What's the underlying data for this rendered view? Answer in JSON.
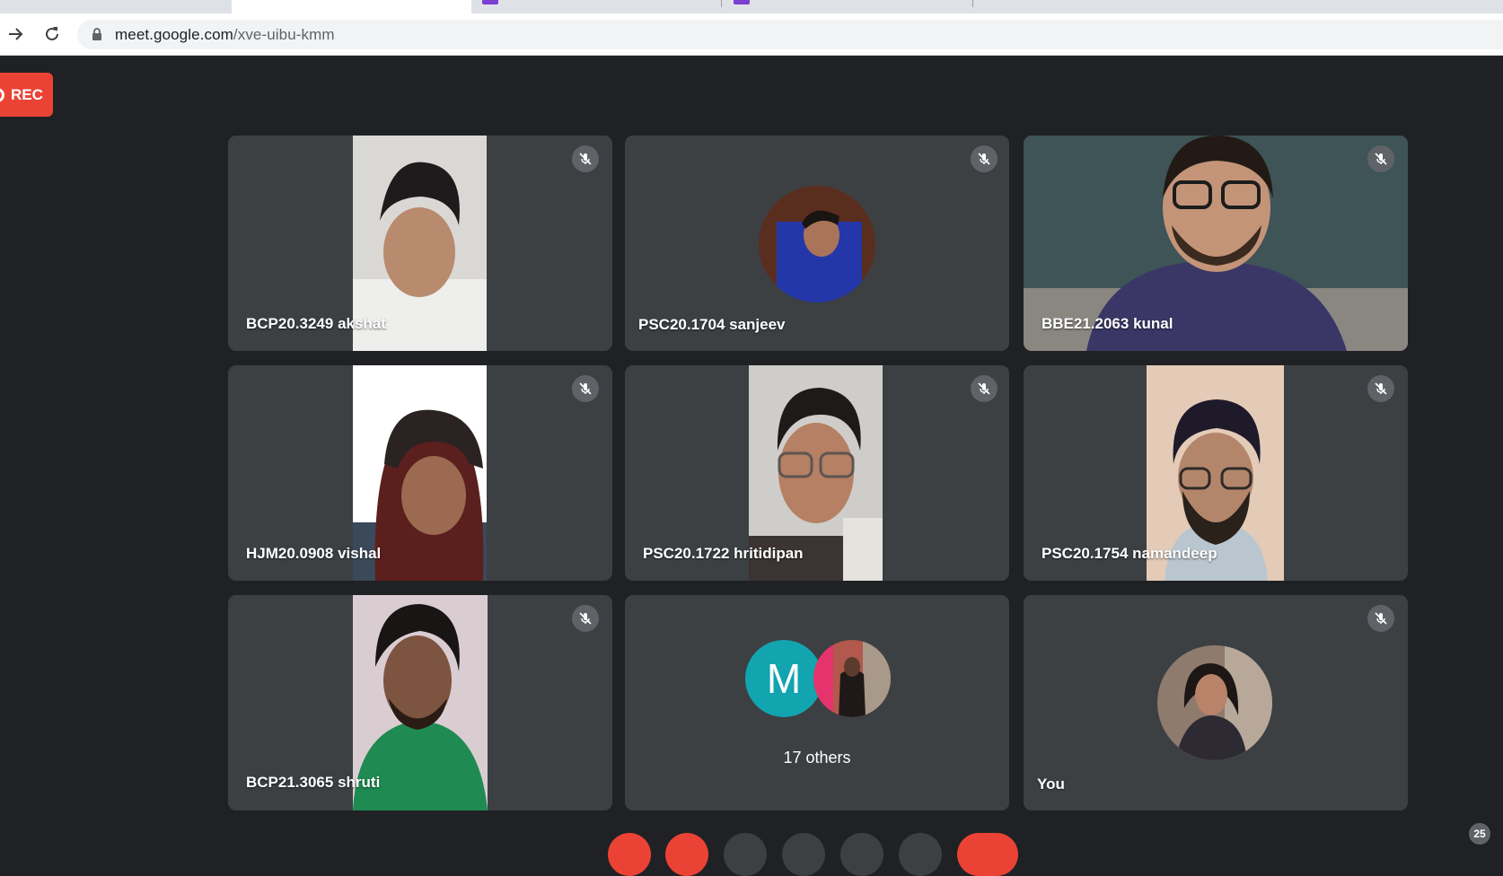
{
  "browser": {
    "url_host": "meet.google.com",
    "url_path": "/xve-uibu-kmm"
  },
  "meeting": {
    "rec_label": "REC",
    "participants": [
      {
        "name": "BCP20.3249 akshat",
        "muted": true,
        "view": "video"
      },
      {
        "name": "PSC20.1704 sanjeev",
        "muted": true,
        "view": "avatar"
      },
      {
        "name": "BBE21.2063 kunal",
        "muted": true,
        "view": "video"
      },
      {
        "name": "HJM20.0908 vishal",
        "muted": true,
        "view": "video"
      },
      {
        "name": "PSC20.1722 hritidipan",
        "muted": true,
        "view": "video"
      },
      {
        "name": "PSC20.1754 namandeep",
        "muted": true,
        "view": "video"
      },
      {
        "name": "BCP21.3065 shruti",
        "muted": true,
        "view": "video"
      },
      {
        "name": "You",
        "muted": true,
        "view": "avatar"
      }
    ],
    "others": {
      "initial": "M",
      "label": "17 others"
    },
    "participant_count": "25"
  },
  "colors": {
    "background": "#202124",
    "tile": "#3c4043",
    "rec": "#ea4335",
    "others_avatar": "#12a4af",
    "end_call": "#ea4335"
  }
}
